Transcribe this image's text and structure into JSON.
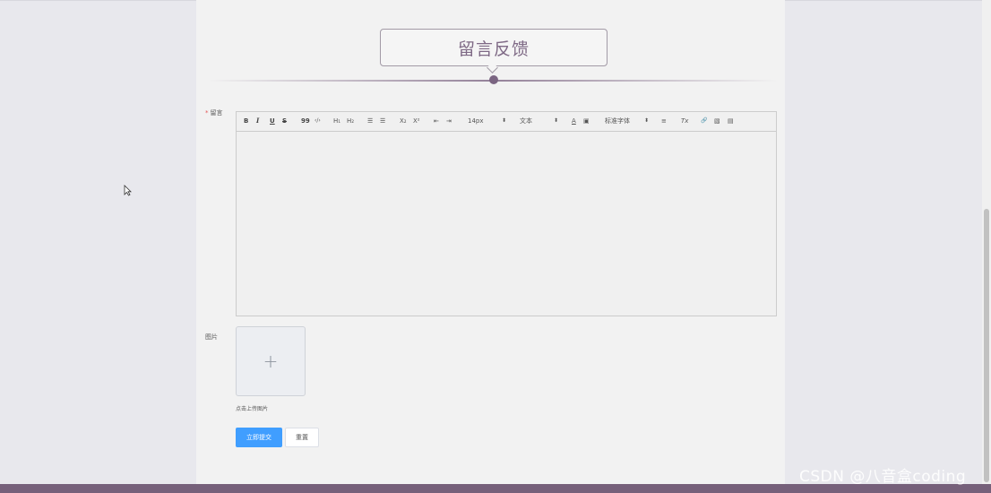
{
  "page": {
    "title": "留言反馈"
  },
  "form": {
    "message_label": "留言",
    "required_mark": "*",
    "image_label": "图片",
    "upload_icon": "+",
    "upload_tip": "点击上传图片",
    "submit_label": "立即提交",
    "reset_label": "重置"
  },
  "editor": {
    "toolbar": {
      "bold": "B",
      "italic": "I",
      "underline": "U",
      "strike": "S",
      "blockquote": "99",
      "code": "‹/›",
      "h1": "H₁",
      "h2": "H₂",
      "ordered_list": "☰",
      "bullet_list": "☰",
      "subscript": "X₂",
      "superscript": "X²",
      "outdent": "⇤",
      "indent": "⇥",
      "font_size": "14px",
      "text_type": "文本",
      "font_color": "A",
      "background_color": "▣",
      "font_family": "标准字体",
      "align": "≡",
      "clean": "Tx",
      "link": "🔗",
      "image": "▧",
      "video": "▤",
      "dropdown_arrow": "⬍"
    }
  },
  "watermark": "CSDN @八音盒coding"
}
